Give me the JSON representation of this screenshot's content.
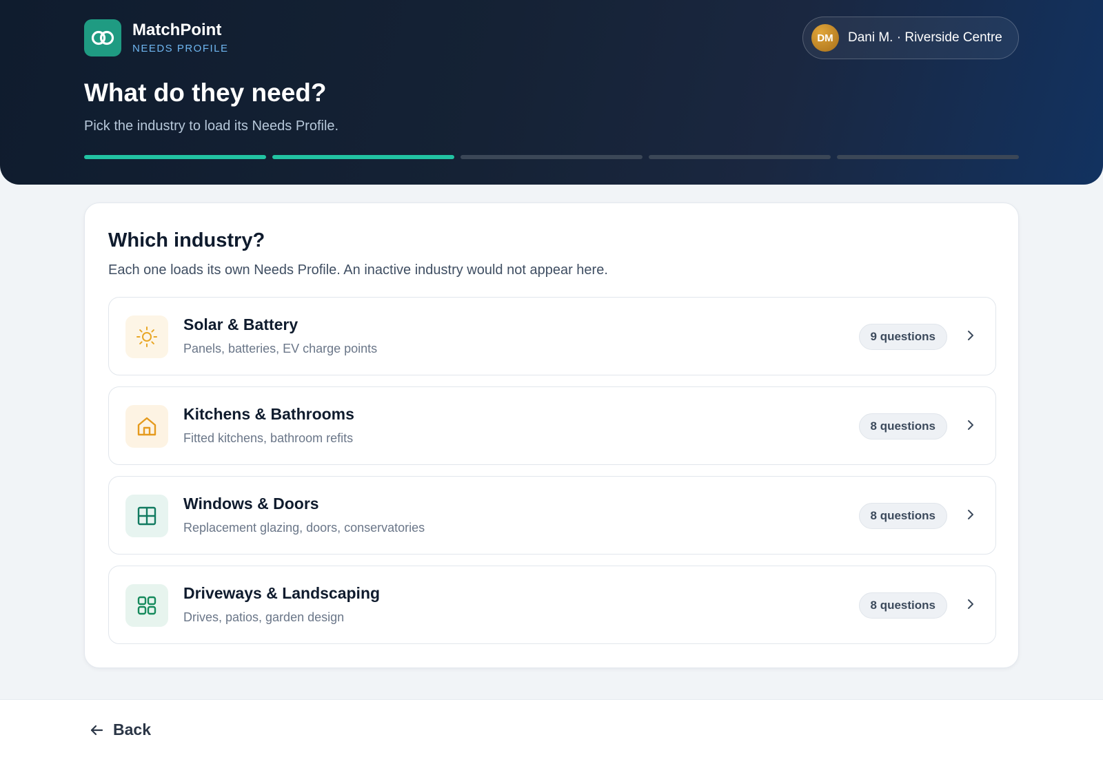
{
  "app": {
    "name": "MatchPoint",
    "section": "NEEDS PROFILE"
  },
  "user": {
    "initials": "DM",
    "label": "Dani M. · Riverside Centre"
  },
  "hero": {
    "title": "What do they need?",
    "subtitle": "Pick the industry to load its Needs Profile.",
    "progress": {
      "total_steps": 5,
      "completed_steps": 2
    }
  },
  "card": {
    "title": "Which industry?",
    "description": "Each one loads its own Needs Profile. An inactive industry would not appear here."
  },
  "industries": [
    {
      "name": "Solar & Battery",
      "description": "Panels, batteries, EV charge points",
      "questions": "9 questions",
      "icon": "sun-icon",
      "icon_bg": "#fdf5e6",
      "icon_color": "#e8a624"
    },
    {
      "name": "Kitchens & Bathrooms",
      "description": "Fitted kitchens, bathroom refits",
      "questions": "8 questions",
      "icon": "home-icon",
      "icon_bg": "#fdf3e3",
      "icon_color": "#e59a1d"
    },
    {
      "name": "Windows & Doors",
      "description": "Replacement glazing, doors, conservatories",
      "questions": "8 questions",
      "icon": "window-icon",
      "icon_bg": "#e7f4f0",
      "icon_color": "#117a60"
    },
    {
      "name": "Driveways & Landscaping",
      "description": "Drives, patios, garden design",
      "questions": "8 questions",
      "icon": "grid-icon",
      "icon_bg": "#e7f4ee",
      "icon_color": "#158a5c"
    }
  ],
  "footer": {
    "back_label": "Back"
  },
  "colors": {
    "accent": "#22c3a2",
    "brand_tile": "#1f9b82",
    "hero_bg": "#152235"
  }
}
